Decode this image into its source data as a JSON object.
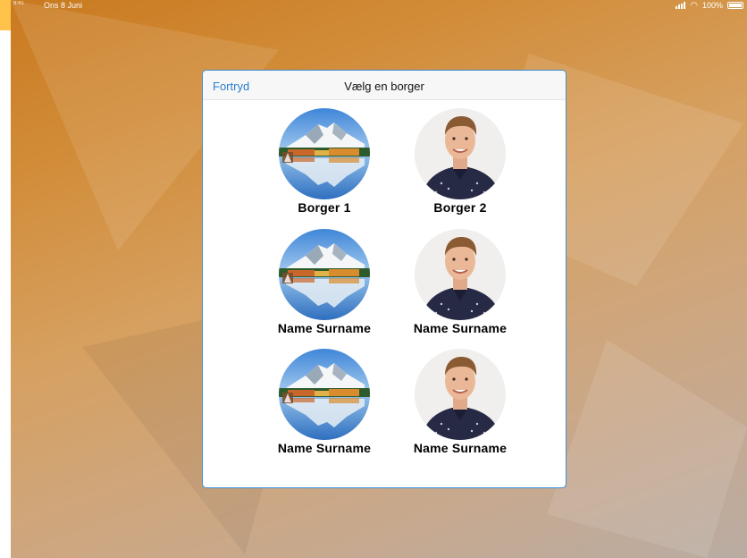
{
  "status_bar": {
    "time": "9:41",
    "date": "Ons 8 Juni",
    "battery": "100%"
  },
  "dialog": {
    "cancel_label": "Fortryd",
    "title": "Vælg en borger"
  },
  "citizens": [
    {
      "name": "Borger 1",
      "avatar": "mountain-lake-photo"
    },
    {
      "name": "Borger 2",
      "avatar": "person-portrait-photo"
    },
    {
      "name": "Name Surname",
      "avatar": "mountain-lake-photo"
    },
    {
      "name": "Name Surname",
      "avatar": "person-portrait-photo"
    },
    {
      "name": "Name Surname",
      "avatar": "mountain-lake-photo"
    },
    {
      "name": "Name Surname",
      "avatar": "person-portrait-photo"
    }
  ],
  "colors": {
    "accent": "#2a7ed0",
    "dialog_border": "#3b8fd6",
    "background_top": "#c97a1f",
    "background_bottom": "#b9aca2"
  }
}
